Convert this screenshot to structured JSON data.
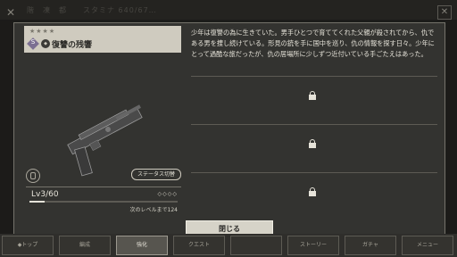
{
  "top_status": "階　凍　都　　スタミナ 640/67…",
  "weapon": {
    "stars": "★★★★",
    "rarity_letter": "S",
    "name": "復讐の残響",
    "status_switch": "ステータス切替",
    "level": "Lv3/60",
    "diamonds": "◇◇◇◇",
    "level_progress_fraction": 0.1,
    "next_level": "次のレベルまで124"
  },
  "story": "少年は復讐の為に生きていた。男手ひとつで育ててくれた父親が殺されてから、仇である男を捜し続けている。形見の銃を手に国中を巡り、仇の情報を探す日々。少年にとって過酷な旅だったが、仇の居場所に少しずつ近付いている手ごたえはあった。",
  "close_label": "閉じる",
  "nav": [
    {
      "label": "◆トップ"
    },
    {
      "label": "編成"
    },
    {
      "label": "強化"
    },
    {
      "label": "クエスト"
    },
    {
      "label": "ストーリー"
    },
    {
      "label": "ガチャ"
    },
    {
      "label": "メニュー"
    }
  ]
}
